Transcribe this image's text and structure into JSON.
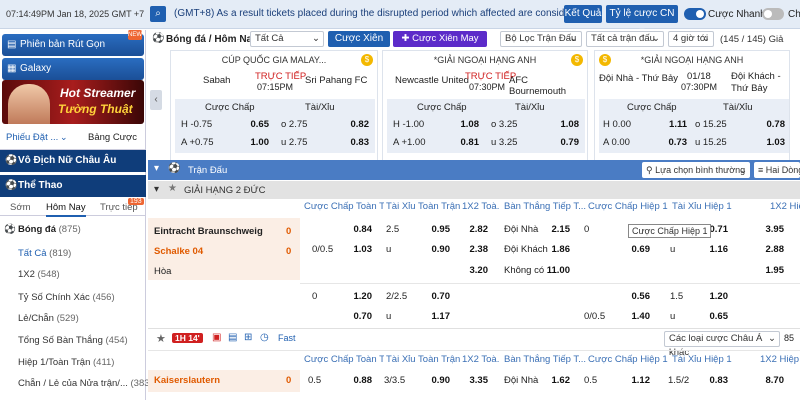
{
  "topbar": {
    "time": "07:14:49PM Jan 18, 2025 GMT +7",
    "announcement": "(GMT+8) As a result tickets placed during the disrupted period which affected are considered",
    "results_button": "Kết Quả",
    "odds_type": "Tỷ lệ cược CN",
    "quick_bet_label": "Cược Nhanh",
    "chat_label": "Ch"
  },
  "left": {
    "fund_button": "Phiên bản Rút Gọn",
    "galaxy_button": "Galaxy",
    "banner_line1": "Hot Streamer",
    "banner_line2": "Tường Thuật",
    "tab_bets": "Phiếu Đặt ...",
    "tab_table": "Bảng Cược",
    "section_women": "Vô Địch Nữ Châu Âu",
    "section_sports": "Thể Thao",
    "sport_tabs": [
      "Sớm",
      "Hôm Nay",
      "Trực tiếp"
    ],
    "live_count": "193",
    "items": [
      {
        "label": "Bóng đá",
        "count": "(875)"
      },
      {
        "label": "Tất Cả",
        "count": "(819)"
      },
      {
        "label": "1X2",
        "count": "(548)"
      },
      {
        "label": "Tỷ Số Chính Xác",
        "count": "(456)"
      },
      {
        "label": "Lẻ/Chẵn",
        "count": "(529)"
      },
      {
        "label": "Tổng Số Bàn Thắng",
        "count": "(454)"
      },
      {
        "label": "Hiệp 1/Toàn Trận",
        "count": "(411)"
      },
      {
        "label": "Chẵn / Lẻ của Nửa trận/...",
        "count": "(383)"
      }
    ]
  },
  "filter": {
    "title": "Bóng đá / Hôm Nay",
    "all": "Tất Cả",
    "parlay": "Cược Xiên",
    "lucky_parlay": "Cược Xiên May Mắn",
    "match_filter": "Bộ Lọc Trận Đấu",
    "all_matches": "Tất cả trận đấu",
    "hours": "4 giờ tới",
    "count": "(145 / 145) Giả"
  },
  "cards": [
    {
      "league": "CÚP QUỐC GIA MALAY...",
      "home": "Sabah",
      "away": "Sri Pahang FC",
      "live": "TRỰC TIẾP",
      "time": "07:15PM",
      "h1": "Cược Chấp",
      "h2": "Tài/Xỉu",
      "r1": [
        "H -0.75",
        "0.65",
        "o 2.75",
        "0.82"
      ],
      "r2": [
        "A +0.75",
        "1.00",
        "u 2.75",
        "0.83"
      ]
    },
    {
      "league": "*GIẢI NGOẠI HẠNG ANH",
      "home": "Newcastle United",
      "away": "AFC Bournemouth",
      "live": "TRỰC TIẾP",
      "time": "07:30PM",
      "h1": "Cược Chấp",
      "h2": "Tài/Xỉu",
      "r1": [
        "H -1.00",
        "1.08",
        "o 3.25",
        "1.08"
      ],
      "r2": [
        "A +1.00",
        "0.81",
        "u 3.25",
        "0.79"
      ]
    },
    {
      "league": "*GIẢI NGOẠI HẠNG ANH",
      "home": "Đội Nhà - Thứ Bảy",
      "away": "Đội Khách - Thứ Bảy",
      "live": "01/18",
      "time": "07:30PM",
      "h1": "Cược Chấp",
      "h2": "Tài/Xỉu",
      "r1": [
        "H 0.00",
        "1.11",
        "o 15.25",
        "0.78"
      ],
      "r2": [
        "A 0.00",
        "0.73",
        "u 15.25",
        "1.03"
      ]
    }
  ],
  "band": {
    "title": "Trận Đấu",
    "sort": "Lựa chọn bình thường",
    "two_lines": "Hai Dòng"
  },
  "league1": {
    "name": "GIẢI HẠNG 2 ĐỨC"
  },
  "columns": [
    "Cược Chấp Toàn T...",
    "Tài Xỉu Toàn Trận",
    "1X2 Toà...",
    "Bàn Thắng Tiếp T...",
    "Cược Chấp Hiệp 1",
    "Tài Xỉu Hiệp 1",
    "1X2 Hiệp 1"
  ],
  "match1": {
    "home": "Eintracht Braunschweig",
    "away": "Schalke 04",
    "draw": "Hòa",
    "score_home": "0",
    "score_away": "0",
    "row1": {
      "hdp": "",
      "hdp_odd": "0.84",
      "ou": "2.5",
      "ou_odd": "0.95",
      "x12": "2.82",
      "next_label": "Đội Nhà",
      "next_odd": "2.15",
      "h1hdp": "0",
      "h1hdp_odd": "0.71",
      "h1ou": "",
      "h1ou_odd": "",
      "h1x12": "3.95"
    },
    "row2": {
      "hdp": "0/0.5",
      "hdp_odd": "1.03",
      "ou": "u",
      "ou_odd": "0.90",
      "x12": "2.38",
      "next_label": "Đội Khách",
      "next_odd": "1.86",
      "h1hdp_odd": "0.69",
      "h1ou": "u",
      "h1ou_odd": "1.16",
      "h1x12": "2.88"
    },
    "row3": {
      "x12": "3.20",
      "next_label": "Không có",
      "next_odd": "11.00",
      "h1x12": "1.95"
    },
    "alt1": {
      "hdp": "0",
      "hdp_odd": "1.20",
      "ou": "2/2.5",
      "ou_odd": "0.70",
      "h1hdp_odd": "0.56",
      "h1ou": "1.5",
      "h1ou_odd": "1.20"
    },
    "alt2": {
      "hdp_odd": "0.70",
      "ou": "u",
      "ou_odd": "1.17",
      "h1hdp": "0/0.5",
      "h1hdp_odd": "1.40",
      "h1ou": "u",
      "h1ou_odd": "0.65"
    },
    "tooltip": "Cược Chấp Hiệp 1"
  },
  "live_bar": {
    "period": "1H 14'",
    "fast": "Fast",
    "other": "Các loại cược Châu Á khác"
  },
  "columns2": [
    "Cược Chấp Toàn T...",
    "Tài Xỉu Toàn Trận",
    "1X2 Toà...",
    "Bàn Thắng Tiếp T...",
    "Cược Chấp Hiệp 1",
    "Tài Xỉu Hiệp 1",
    "1X2 Hiệp 1"
  ],
  "match2": {
    "home": "Kaiserslautern",
    "score": "0",
    "hdp": "0.5",
    "hdp_odd": "0.88",
    "ou": "3/3.5",
    "ou_odd": "0.90",
    "x12": "3.35",
    "next_label": "Đội Nhà",
    "next_odd": "1.62",
    "h1hdp": "0.5",
    "h1hdp_odd": "1.12",
    "h1ou": "1.5/2",
    "h1ou_odd": "0.83",
    "h1x12": "8.70"
  },
  "colors": {
    "brand": "#1f5fb0",
    "live": "#d02020",
    "score": "#e05a00",
    "band": "#4a7cc4"
  }
}
